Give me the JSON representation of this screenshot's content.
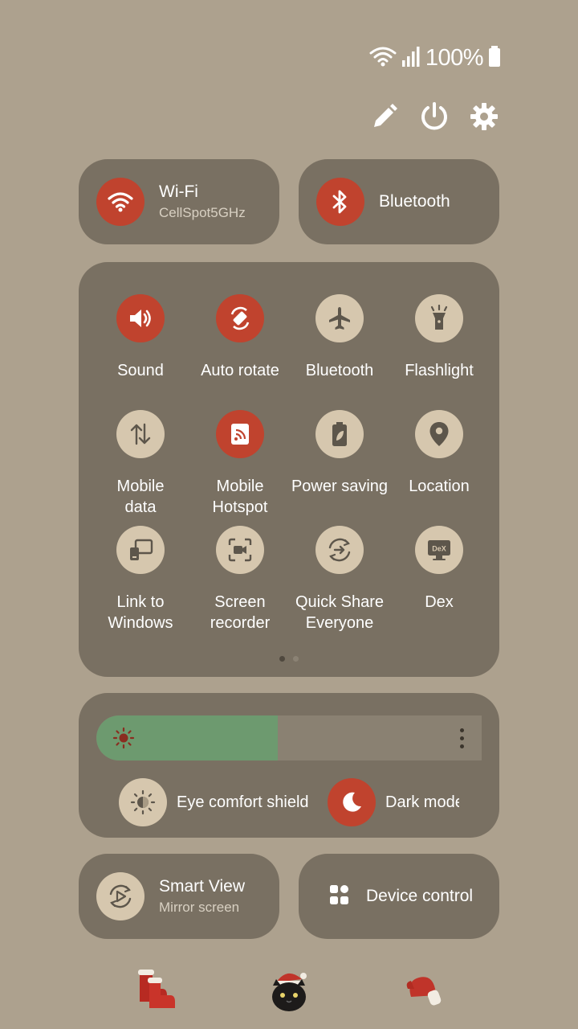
{
  "status": {
    "battery_text": "100%"
  },
  "top_actions": [
    "pencil-icon",
    "power-icon",
    "gear-icon"
  ],
  "large_tiles": [
    {
      "title": "Wi-Fi",
      "subtitle": "CellSpot5GHz",
      "state": "on"
    },
    {
      "title": "Bluetooth",
      "subtitle": "",
      "state": "on"
    }
  ],
  "quick_settings": [
    {
      "label": "Sound",
      "icon": "sound-icon",
      "state": "on"
    },
    {
      "label": "Auto rotate",
      "icon": "auto-rotate-icon",
      "state": "on"
    },
    {
      "label": "Bluetooth",
      "icon": "airplane-icon",
      "state": "off"
    },
    {
      "label": "Flashlight",
      "icon": "flashlight-icon",
      "state": "off"
    },
    {
      "label": "Mobile\ndata",
      "icon": "mobile-data-icon",
      "state": "off"
    },
    {
      "label": "Mobile\nHotspot",
      "icon": "hotspot-icon",
      "state": "on"
    },
    {
      "label": "Power saving",
      "icon": "battery-leaf-icon",
      "state": "off"
    },
    {
      "label": "Location",
      "icon": "location-pin-icon",
      "state": "off"
    },
    {
      "label": "Link to\nWindows",
      "icon": "link-windows-icon",
      "state": "off"
    },
    {
      "label": "Screen\nrecorder",
      "icon": "screen-recorder-icon",
      "state": "off"
    },
    {
      "label": "Quick Share\nEveryone",
      "icon": "quick-share-icon",
      "state": "off"
    },
    {
      "label": "Dex",
      "icon": "dex-icon",
      "state": "off"
    }
  ],
  "pages": {
    "current": 1,
    "total": 2
  },
  "brightness": {
    "level": 0.47
  },
  "display_toggles": [
    {
      "label": "Eye comfort shield",
      "icon": "eye-comfort-icon",
      "state": "off"
    },
    {
      "label": "Dark mode",
      "icon": "moon-icon",
      "state": "on"
    }
  ],
  "bottom_tiles": [
    {
      "title": "Smart View",
      "subtitle": "Mirror screen",
      "icon": "smart-view-icon"
    },
    {
      "title": "Device control",
      "subtitle": "",
      "icon": "device-control-icon"
    }
  ],
  "colors": {
    "background": "#ada18e",
    "card": "#797062",
    "accent_on": "#c0432e",
    "accent_off": "#d6c7ae",
    "brightness_fill": "#6d9a6f"
  }
}
